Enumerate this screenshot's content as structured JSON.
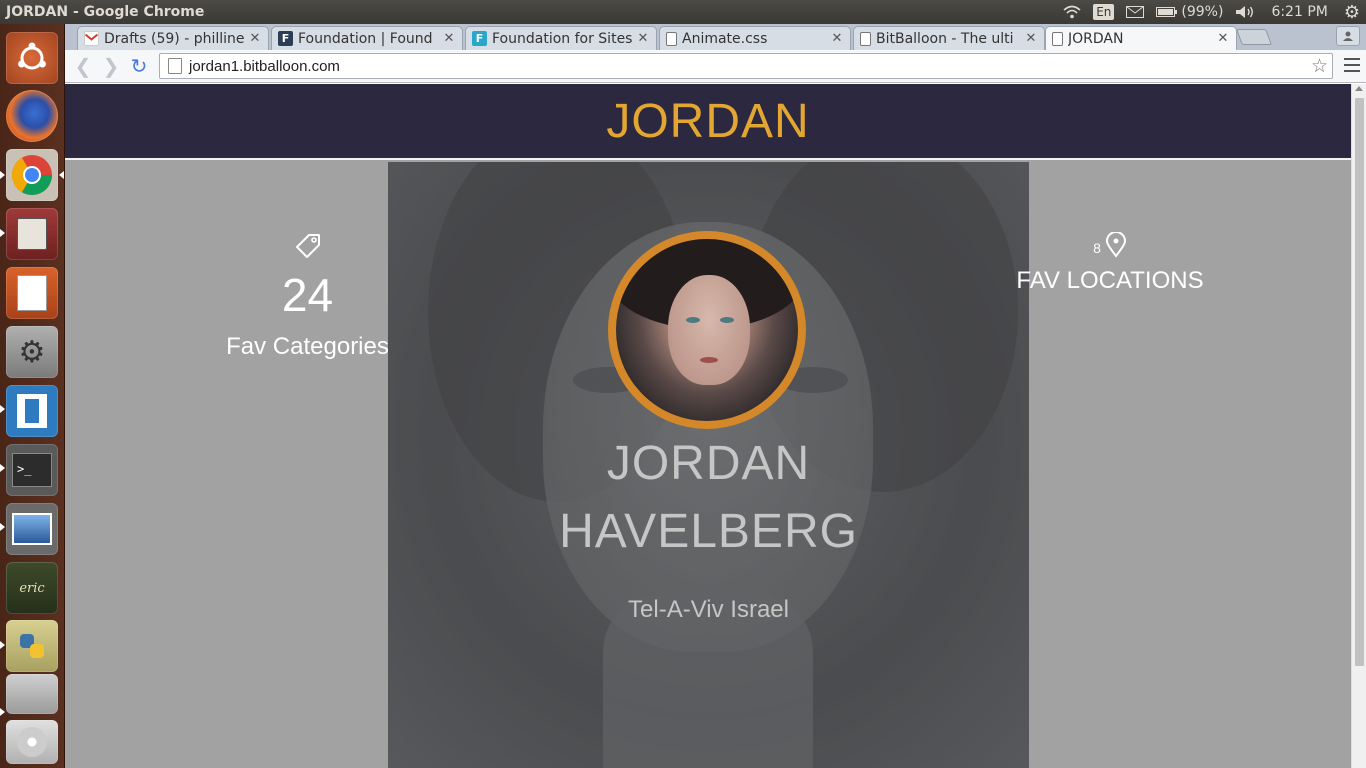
{
  "os": {
    "window_title": "JORDAN - Google Chrome",
    "keyboard": "En",
    "battery": "(99%)",
    "time": "6:21 PM"
  },
  "launcher": {
    "items": [
      "ubuntu-dash",
      "firefox",
      "chrome",
      "file-cabinet",
      "impress",
      "system-settings",
      "brackets",
      "terminal",
      "image-viewer",
      "eric",
      "python-editor",
      "scanner",
      "disc"
    ]
  },
  "browser": {
    "tabs": [
      {
        "label": "Drafts (59) - philline",
        "favicon": "gmail-icon"
      },
      {
        "label": "Foundation | Found",
        "favicon": "foundation-icon"
      },
      {
        "label": "Foundation for Sites",
        "favicon": "foundation-sites-icon"
      },
      {
        "label": "Animate.css",
        "favicon": "page-icon"
      },
      {
        "label": "BitBalloon - The ulti",
        "favicon": "page-icon"
      },
      {
        "label": "JORDAN",
        "favicon": "page-icon"
      }
    ],
    "url": "jordan1.bitballoon.com"
  },
  "page": {
    "site_title": "JORDAN",
    "name_line1": "JORDAN",
    "name_line2": "HAVELBERG",
    "location": "Tel-A-Viv Israel",
    "stat_left": {
      "value": "24",
      "label": "Fav Categories",
      "icon": "tag-icon"
    },
    "stat_right": {
      "value": "8",
      "label": "FAV LOCATIONS",
      "icon": "map-pin-icon"
    }
  },
  "colors": {
    "header_bg": "#2b2840",
    "title_accent": "#e3a631",
    "avatar_ring": "#d4882a",
    "page_bg": "#a2a2a2"
  }
}
